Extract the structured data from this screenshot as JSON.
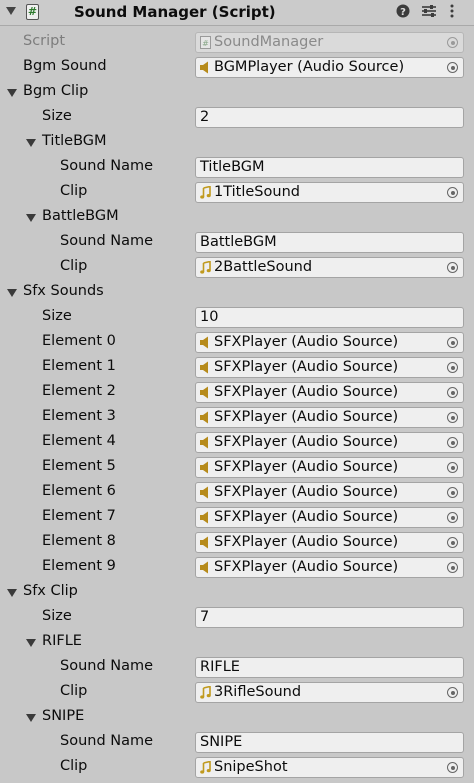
{
  "header": {
    "title": "Sound Manager (Script)",
    "icons": [
      "fold-arrow-icon",
      "script-icon",
      "help-icon",
      "preset-icon",
      "kebab-menu-icon"
    ]
  },
  "script": {
    "label": "Script",
    "value": "SoundManager"
  },
  "bgm_sound": {
    "label": "Bgm Sound",
    "value": "BGMPlayer (Audio Source)"
  },
  "bgm_clip": {
    "label": "Bgm Clip",
    "size_label": "Size",
    "size": "2",
    "items": [
      {
        "label": "TitleBGM",
        "sound_name_label": "Sound Name",
        "sound_name": "TitleBGM",
        "clip_label": "Clip",
        "clip": "1TitleSound"
      },
      {
        "label": "BattleBGM",
        "sound_name_label": "Sound Name",
        "sound_name": "BattleBGM",
        "clip_label": "Clip",
        "clip": "2BattleSound"
      }
    ]
  },
  "sfx_sounds": {
    "label": "Sfx Sounds",
    "size_label": "Size",
    "size": "10",
    "elements": [
      {
        "label": "Element 0",
        "value": "SFXPlayer (Audio Source)"
      },
      {
        "label": "Element 1",
        "value": "SFXPlayer (Audio Source)"
      },
      {
        "label": "Element 2",
        "value": "SFXPlayer (Audio Source)"
      },
      {
        "label": "Element 3",
        "value": "SFXPlayer (Audio Source)"
      },
      {
        "label": "Element 4",
        "value": "SFXPlayer (Audio Source)"
      },
      {
        "label": "Element 5",
        "value": "SFXPlayer (Audio Source)"
      },
      {
        "label": "Element 6",
        "value": "SFXPlayer (Audio Source)"
      },
      {
        "label": "Element 7",
        "value": "SFXPlayer (Audio Source)"
      },
      {
        "label": "Element 8",
        "value": "SFXPlayer (Audio Source)"
      },
      {
        "label": "Element 9",
        "value": "SFXPlayer (Audio Source)"
      }
    ]
  },
  "sfx_clip": {
    "label": "Sfx Clip",
    "size_label": "Size",
    "size": "7",
    "items": [
      {
        "label": "RIFLE",
        "sound_name_label": "Sound Name",
        "sound_name": "RIFLE",
        "clip_label": "Clip",
        "clip": "3RifleSound"
      },
      {
        "label": "SNIPE",
        "sound_name_label": "Sound Name",
        "sound_name": "SNIPE",
        "clip_label": "Clip",
        "clip": "SnipeShot"
      }
    ]
  },
  "colors": {
    "panel_bg": "#c8c8c8",
    "field_bg": "#efefef",
    "speaker_icon": "#b68a1a",
    "music_icon": "#c09a1e"
  }
}
